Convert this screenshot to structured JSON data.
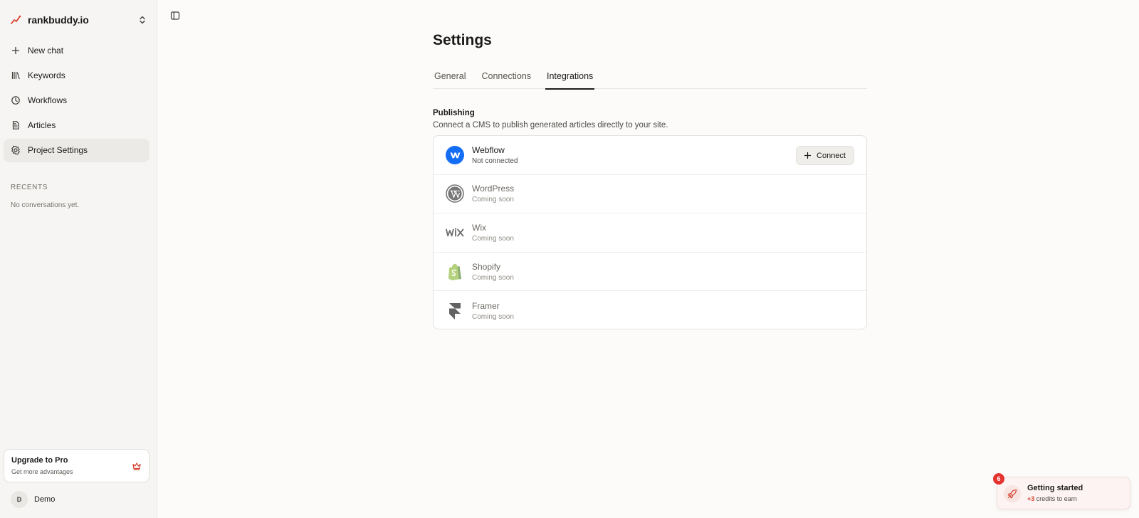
{
  "sidebar": {
    "brand": "rankbuddy.io",
    "nav": [
      {
        "label": "New chat",
        "icon": "plus-icon"
      },
      {
        "label": "Keywords",
        "icon": "library-icon"
      },
      {
        "label": "Workflows",
        "icon": "clock-icon"
      },
      {
        "label": "Articles",
        "icon": "document-icon"
      },
      {
        "label": "Project Settings",
        "icon": "gear-icon",
        "active": true
      }
    ],
    "recents_title": "RECENTS",
    "recents_empty": "No conversations yet.",
    "upgrade": {
      "title": "Upgrade to Pro",
      "subtitle": "Get more advantages"
    },
    "user": {
      "initial": "D",
      "name": "Demo"
    }
  },
  "main": {
    "title": "Settings",
    "tabs": [
      {
        "label": "General"
      },
      {
        "label": "Connections"
      },
      {
        "label": "Integrations",
        "active": true
      }
    ],
    "section": {
      "title": "Publishing",
      "description": "Connect a CMS to publish generated articles directly to your site."
    },
    "integrations": [
      {
        "name": "Webflow",
        "status": "Not connected",
        "icon": "webflow-icon",
        "action": "Connect"
      },
      {
        "name": "WordPress",
        "status": "Coming soon",
        "icon": "wordpress-icon"
      },
      {
        "name": "Wix",
        "status": "Coming soon",
        "icon": "wix-icon"
      },
      {
        "name": "Shopify",
        "status": "Coming soon",
        "icon": "shopify-icon"
      },
      {
        "name": "Framer",
        "status": "Coming soon",
        "icon": "framer-icon"
      }
    ]
  },
  "toast": {
    "badge": "6",
    "title": "Getting started",
    "credits": "+3",
    "subtitle_rest": " credits to earn"
  },
  "colors": {
    "accent_red": "#e5322e",
    "webflow_blue": "#146ef5",
    "shopify_green": "#95bf47"
  }
}
